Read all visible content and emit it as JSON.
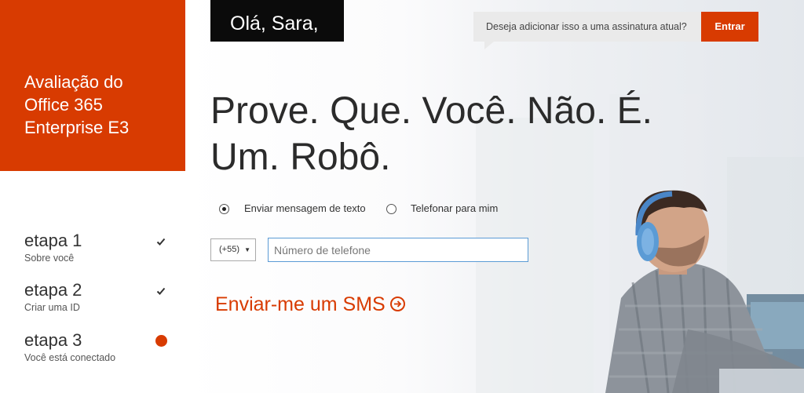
{
  "sidebar": {
    "title": "Avaliação do\nOffice 365\nEnterprise E3",
    "steps": [
      {
        "title": "etapa 1",
        "subtitle": "Sobre você",
        "status": "check"
      },
      {
        "title": "etapa 2",
        "subtitle": "Criar uma ID",
        "status": "check"
      },
      {
        "title": "etapa 3",
        "subtitle": "Você está conectado",
        "status": "current"
      }
    ]
  },
  "header": {
    "greeting": "Olá, Sara,",
    "prompt": "Deseja adicionar isso a uma assinatura atual?",
    "signin_label": "Entrar"
  },
  "main": {
    "headline_line1": "Prove. Que. Você. Não. É.",
    "headline_line2": "Um. Robô.",
    "options": [
      {
        "label": "Enviar mensagem de texto",
        "selected": true
      },
      {
        "label": "Telefonar para mim",
        "selected": false
      }
    ],
    "country_code": "(+55)",
    "phone_placeholder": "Número de telefone",
    "sms_label": "Enviar-me um SMS"
  },
  "colors": {
    "accent": "#d83b01",
    "greeting_bg": "#0b0b0b",
    "input_border": "#5b9bd5"
  },
  "icons": [
    "check-icon",
    "arrow-circle-right-icon",
    "chevron-down-icon"
  ]
}
